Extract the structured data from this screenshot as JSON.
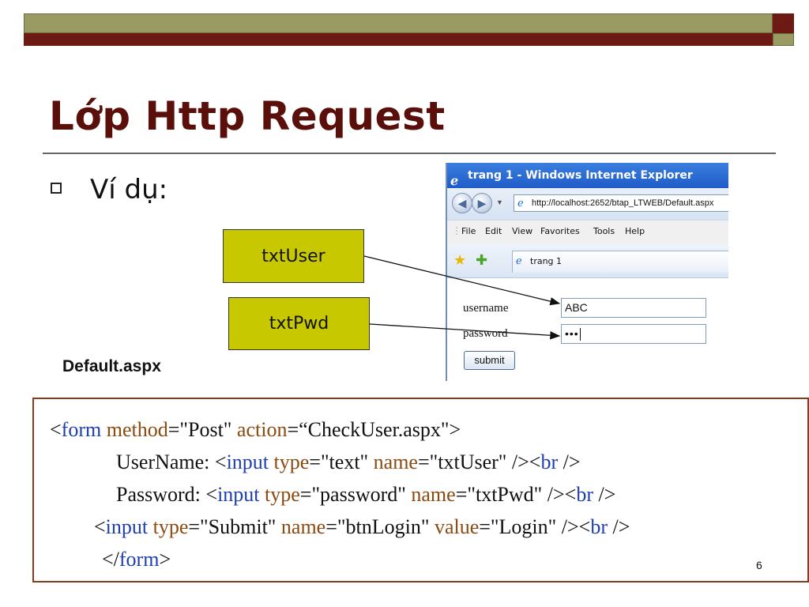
{
  "slide": {
    "title": "Lớp Http Request",
    "bullet": "Ví dụ:",
    "page_number": "6",
    "colors": {
      "maroon": "#6d1a14",
      "olive": "#9a9a63",
      "label_fill": "#c8c800",
      "code_border": "#8b3a1c",
      "tag_blue": "#1f3fb0",
      "attr_brown": "#8b4a10"
    }
  },
  "callouts": {
    "user_label": "txtUser",
    "pwd_label": "txtPwd",
    "file_label": "Default.aspx"
  },
  "browser": {
    "window_title": "trang 1 - Windows Internet Explorer",
    "address": "http://localhost:2652/btap_LTWEB/Default.aspx",
    "menu": [
      "File",
      "Edit",
      "View",
      "Favorites",
      "Tools",
      "Help"
    ],
    "tab_title": "trang 1",
    "icons": [
      "ie-logo-icon",
      "back-icon",
      "forward-icon",
      "favorites-star-icon",
      "add-favorite-icon"
    ],
    "form": {
      "username_label": "username",
      "username_value": "ABC",
      "password_label": "password",
      "password_value": "•••",
      "submit_label": "submit"
    }
  },
  "code": {
    "line1": {
      "p1": "<",
      "tag": "form",
      "sp1": " ",
      "a1": "method",
      "v1": "=\"Post\" ",
      "a2": "action",
      "v2": "=“CheckUser.aspx\">"
    },
    "line2": {
      "p1": "UserName: <",
      "tag": "input",
      "sp1": " ",
      "a1": "type",
      "v1": "=\"text\" ",
      "a2": "name",
      "v2": "=\"txtUser\" /><",
      "tag2": "br",
      "end": " />"
    },
    "line3": {
      "p1": "Password: <",
      "tag": "input",
      "sp1": " ",
      "a1": "type",
      "v1": "=\"password\" ",
      "a2": "name",
      "v2": "=\"txtPwd\" /><",
      "tag2": "br",
      "end": " />"
    },
    "line4": {
      "p1": "<",
      "tag": "input",
      "sp1": " ",
      "a1": "type",
      "v1": "=\"Submit\" ",
      "a2": "name",
      "v2": "=\"btnLogin\" ",
      "a3": "value",
      "v3": "=\"Login\" /><",
      "tag2": "br",
      "end": " />"
    },
    "line5": {
      "p1": "</",
      "tag": "form",
      "end": ">"
    }
  }
}
